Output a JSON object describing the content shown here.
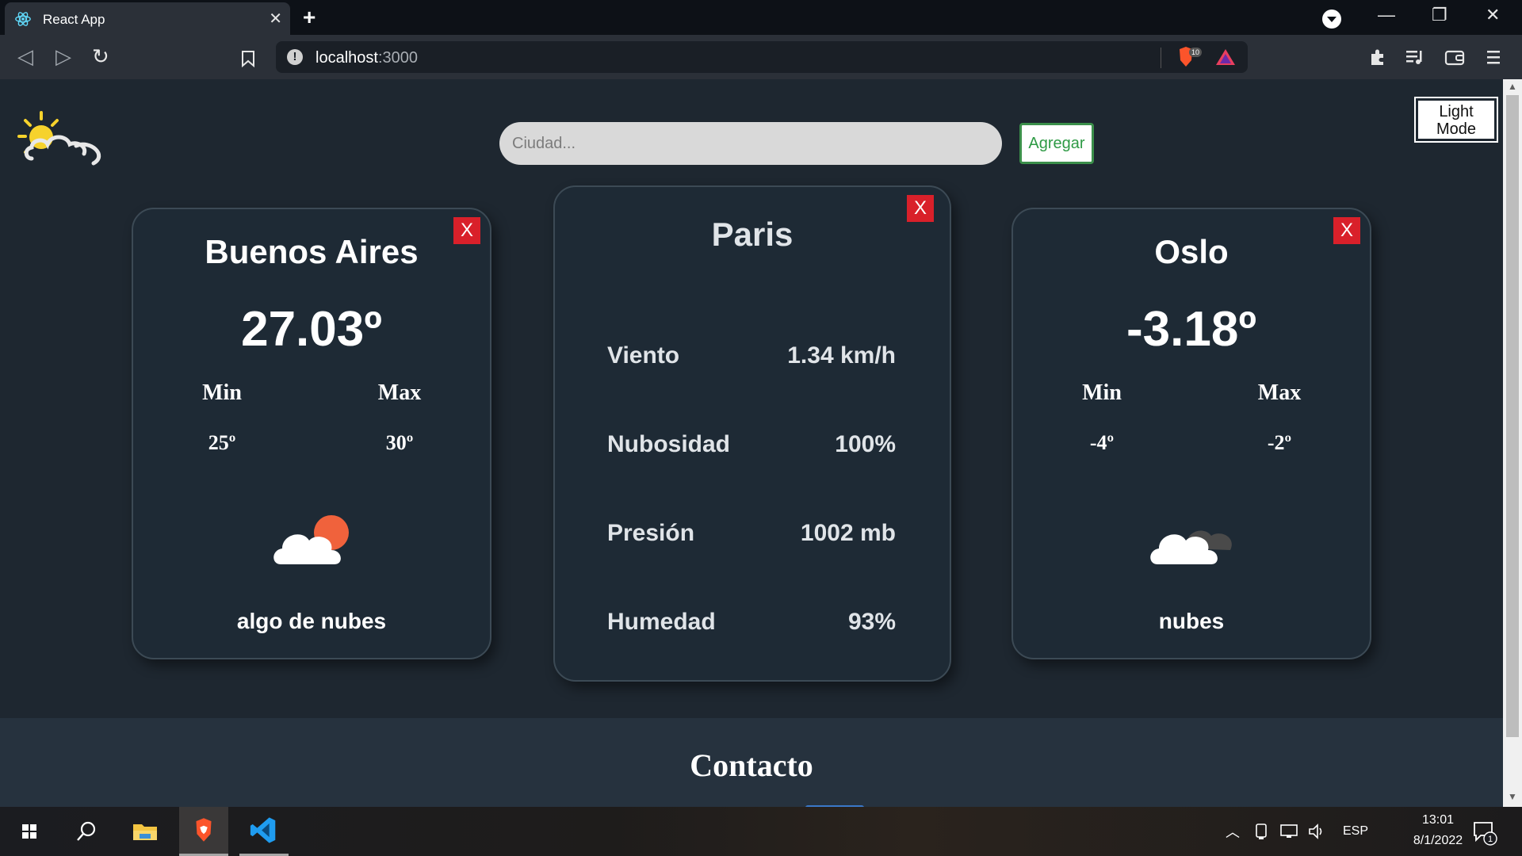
{
  "browser": {
    "tab_title": "React App",
    "tab_close": "✕",
    "new_tab": "+",
    "url_host": "localhost",
    "url_port": ":3000",
    "shield_count": "10",
    "window_controls": {
      "minimize": "—",
      "restore": "❐",
      "close": "✕"
    }
  },
  "header": {
    "search_placeholder": "Ciudad...",
    "add_label": "Agregar",
    "theme_toggle": "Light Mode"
  },
  "cards": [
    {
      "city": "Buenos Aires",
      "temp": "27.03º",
      "min_label": "Min",
      "max_label": "Max",
      "min": "25º",
      "max": "30º",
      "description": "algo de nubes",
      "icon": "cloud-sun-icon",
      "close": "X"
    },
    {
      "city": "Paris",
      "close": "X",
      "details": [
        {
          "label": "Viento",
          "value": "1.34 km/h"
        },
        {
          "label": "Nubosidad",
          "value": "100%"
        },
        {
          "label": "Presión",
          "value": "1002 mb"
        },
        {
          "label": "Humedad",
          "value": "93%"
        }
      ]
    },
    {
      "city": "Oslo",
      "temp": "-3.18º",
      "min_label": "Min",
      "max_label": "Max",
      "min": "-4º",
      "max": "-2º",
      "description": "nubes",
      "icon": "clouds-icon",
      "close": "X"
    }
  ],
  "contact": {
    "title": "Contacto"
  },
  "taskbar": {
    "language": "ESP",
    "time": "13:01",
    "date": "8/1/2022",
    "notification_count": "1"
  },
  "colors": {
    "page_background": "#1e2730",
    "card_background": "#1e2a35",
    "close_button": "#d9202a",
    "add_button_text": "#2e9a45"
  }
}
